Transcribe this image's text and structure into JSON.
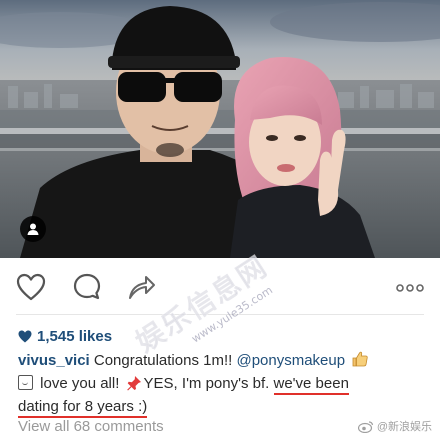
{
  "post": {
    "likes_count": "1,545 likes",
    "caption": {
      "username": "vivus_vici",
      "line1_text": " Congratulations 1m!! ",
      "mention": "@ponysmakeup",
      "line2_text1": " love you all! ",
      "line2_text2": "YES, I'm pony's bf. ",
      "highlight1": "we've been",
      "highlight2": "dating for 8 years :)"
    },
    "view_comments": "View all 68 comments"
  },
  "icons": {
    "user_tag": "person-tag-icon",
    "like": "heart-outline-icon",
    "comment": "comment-bubble-icon",
    "share": "share-arrow-icon",
    "more": "more-dots-icon",
    "likes_heart": "heart-filled-icon",
    "emoji_smile": "smiley-emoji-icon",
    "emoji_pin": "pushpin-emoji-icon",
    "emoji_thumb": "thumbs-up-emoji-icon"
  },
  "watermarks": {
    "diagonal_text": "娱乐信息网",
    "diagonal_url": "www.yule35.com",
    "weibo_handle": "@新浪娱乐"
  },
  "colors": {
    "link_blue": "#1f4e79",
    "underline_red": "#e0302a",
    "muted_gray": "#9a9a9a"
  }
}
